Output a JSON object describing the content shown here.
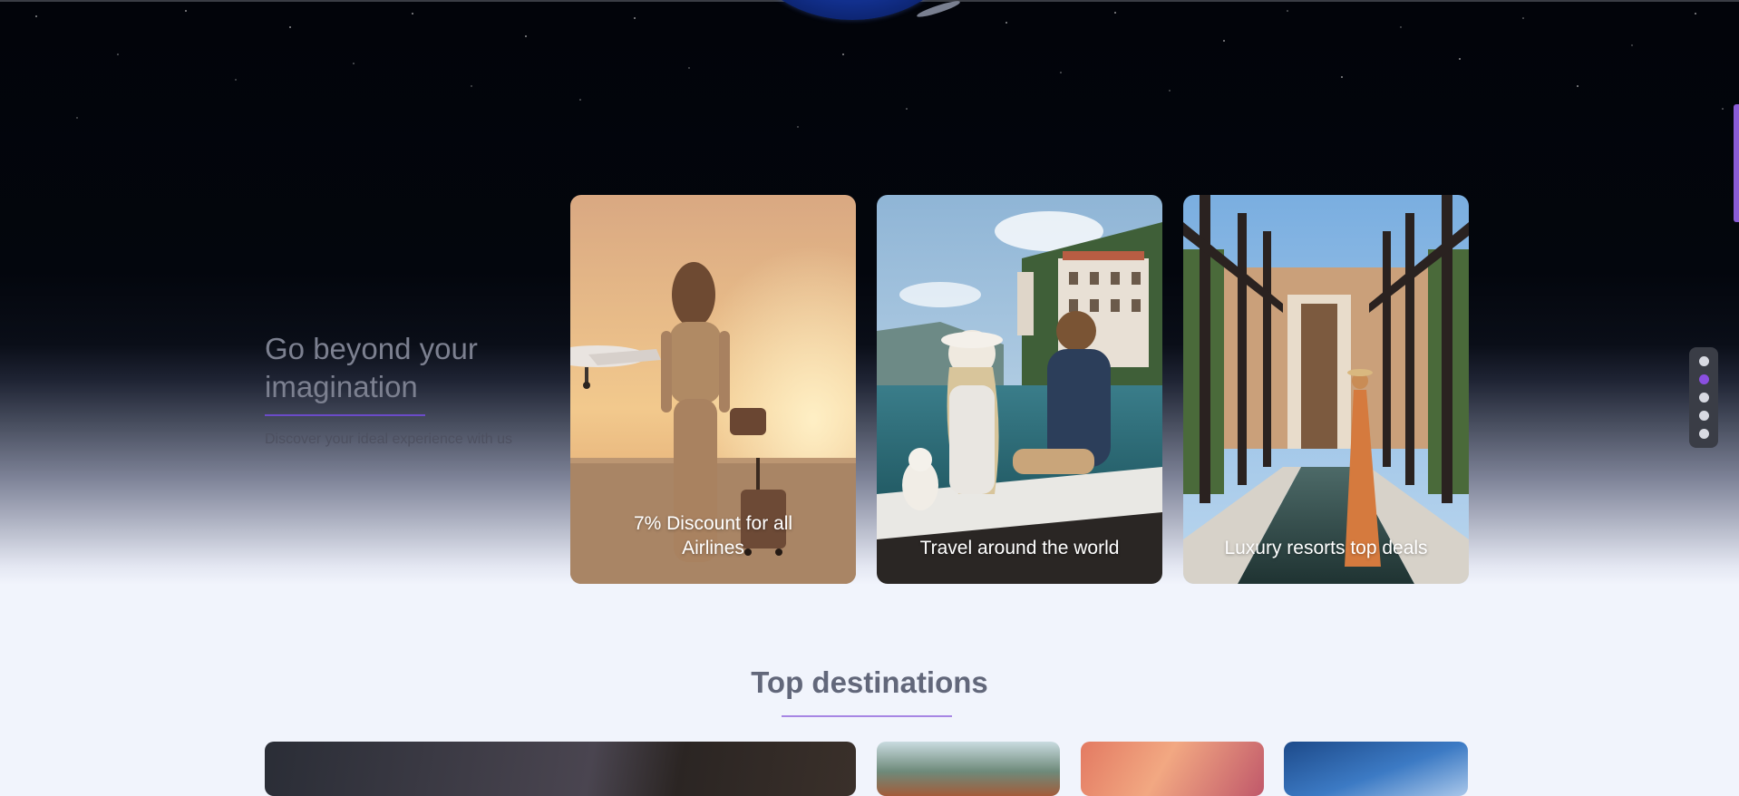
{
  "hero": {
    "headline": "Go beyond your imagination",
    "subtitle": "Discover your ideal experience with us",
    "cards": [
      {
        "caption": "7% Discount for all Airlines",
        "image": "woman-with-suitcase-at-airport"
      },
      {
        "caption": "Travel around the world",
        "image": "couple-on-boat-by-villa"
      },
      {
        "caption": "Luxury resorts top deals",
        "image": "woman-at-resort-pool"
      }
    ]
  },
  "slider": {
    "active_index": 1,
    "dot_count": 5
  },
  "destinations": {
    "title": "Top destinations",
    "tiles": [
      "mountain-portrait",
      "coastal-town",
      "sunset-sky",
      "blue-sky-monument"
    ]
  },
  "colors": {
    "accent": "#8a4fe0",
    "headline_rule": "#6b4bc8",
    "section_rule": "#a786e4",
    "page_background": "#f1f4fc"
  }
}
